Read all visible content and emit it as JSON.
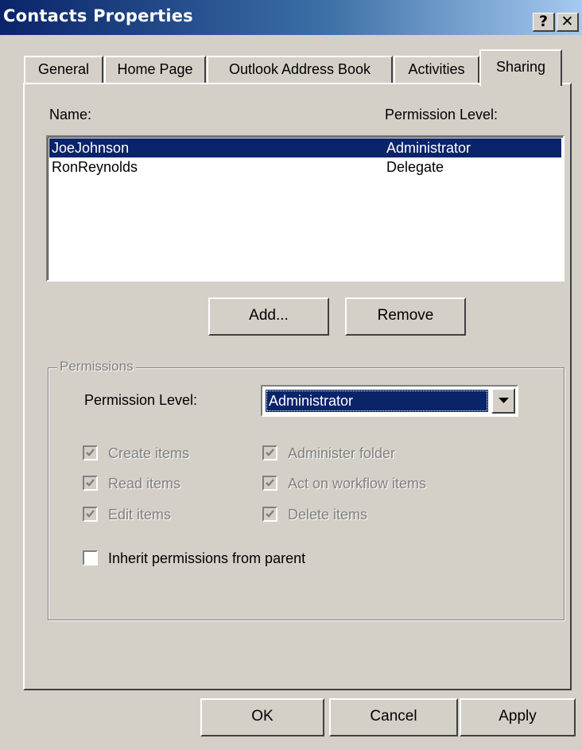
{
  "window": {
    "title": "Contacts Properties",
    "help_label": "?",
    "close_label": "✕"
  },
  "tabs": [
    {
      "label": "General"
    },
    {
      "label": "Home Page"
    },
    {
      "label": "Outlook Address Book"
    },
    {
      "label": "Activities"
    },
    {
      "label": "Sharing",
      "active": true
    }
  ],
  "sharing": {
    "name_header": "Name:",
    "level_header": "Permission Level:",
    "rows": [
      {
        "name": "JoeJohnson",
        "level": "Administrator",
        "selected": true
      },
      {
        "name": "RonReynolds",
        "level": "Delegate",
        "selected": false
      }
    ],
    "add_label": "Add...",
    "remove_label": "Remove"
  },
  "permissions": {
    "group_title": "Permissions",
    "level_label": "Permission Level:",
    "level_value": "Administrator",
    "checkboxes": [
      {
        "label": "Create items",
        "checked": true,
        "enabled": false
      },
      {
        "label": "Administer folder",
        "checked": true,
        "enabled": false
      },
      {
        "label": "Read items",
        "checked": true,
        "enabled": false
      },
      {
        "label": "Act on workflow items",
        "checked": true,
        "enabled": false
      },
      {
        "label": "Edit items",
        "checked": true,
        "enabled": false
      },
      {
        "label": "Delete items",
        "checked": true,
        "enabled": false
      }
    ],
    "inherit_label": "Inherit permissions from parent",
    "inherit_checked": false
  },
  "footer": {
    "ok_label": "OK",
    "cancel_label": "Cancel",
    "apply_label": "Apply"
  },
  "colors": {
    "titlebar_start": "#0a246a",
    "selection": "#0a246a",
    "face": "#d4d0c8"
  }
}
